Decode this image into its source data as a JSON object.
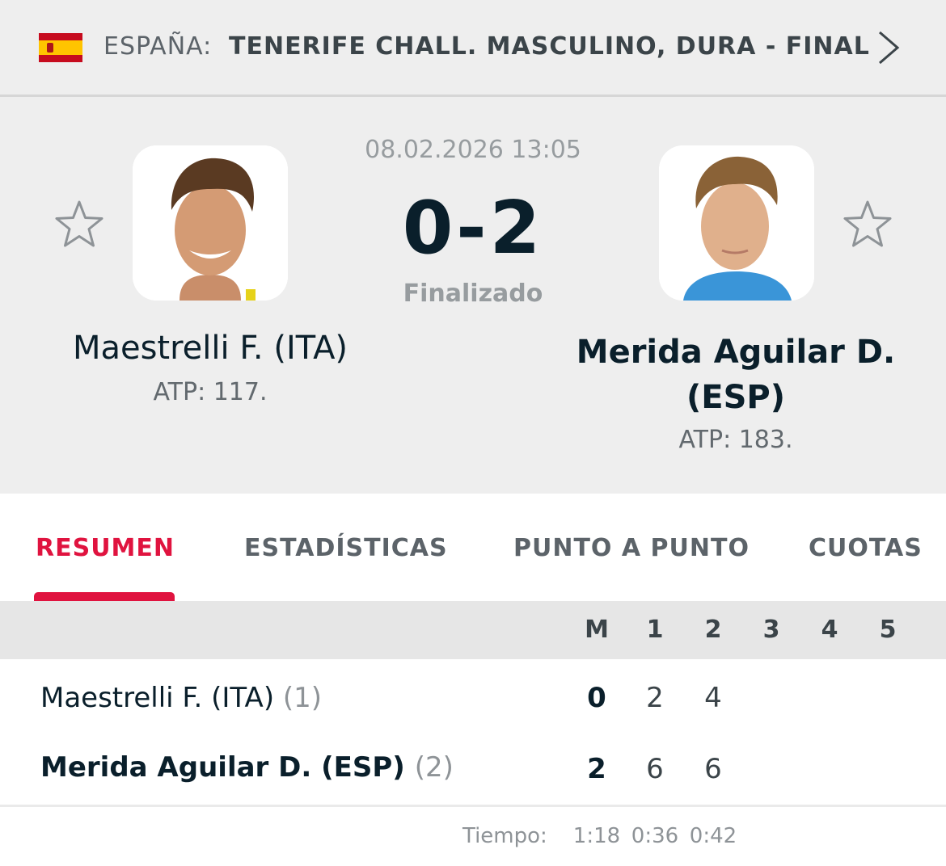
{
  "header": {
    "country": "ESPAÑA:",
    "league": "TENERIFE CHALL. MASCULINO, DURA - FINAL",
    "flag_icon": "spain-flag-icon",
    "nav_icon": "chevron-right-icon"
  },
  "match": {
    "datetime": "08.02.2026 13:05",
    "score": "0-2",
    "status": "Finalizado",
    "home": {
      "name": "Maestrelli F. (ITA)",
      "rank": "ATP: 117."
    },
    "away": {
      "name_line1": "Merida Aguilar D.",
      "name_line2": "(ESP)",
      "rank": "ATP: 183."
    }
  },
  "tabs": [
    {
      "label": "RESUMEN",
      "active": true
    },
    {
      "label": "ESTADÍSTICAS",
      "active": false
    },
    {
      "label": "PUNTO A PUNTO",
      "active": false
    },
    {
      "label": "CUOTAS",
      "active": false
    }
  ],
  "scoreboard": {
    "columns": [
      "M",
      "1",
      "2",
      "3",
      "4",
      "5"
    ],
    "rows": [
      {
        "name": "Maestrelli F. (ITA)",
        "seed": "(1)",
        "match": "0",
        "sets": [
          "2",
          "4"
        ],
        "winner": false
      },
      {
        "name": "Merida Aguilar D. (ESP)",
        "seed": "(2)",
        "match": "2",
        "sets": [
          "6",
          "6"
        ],
        "winner": true
      }
    ],
    "time_label": "Tiempo:",
    "times": [
      "1:18",
      "0:36",
      "0:42"
    ]
  },
  "colors": {
    "accent": "#e0133f",
    "text_dark": "#0a1f2b",
    "muted": "#979c9f"
  }
}
